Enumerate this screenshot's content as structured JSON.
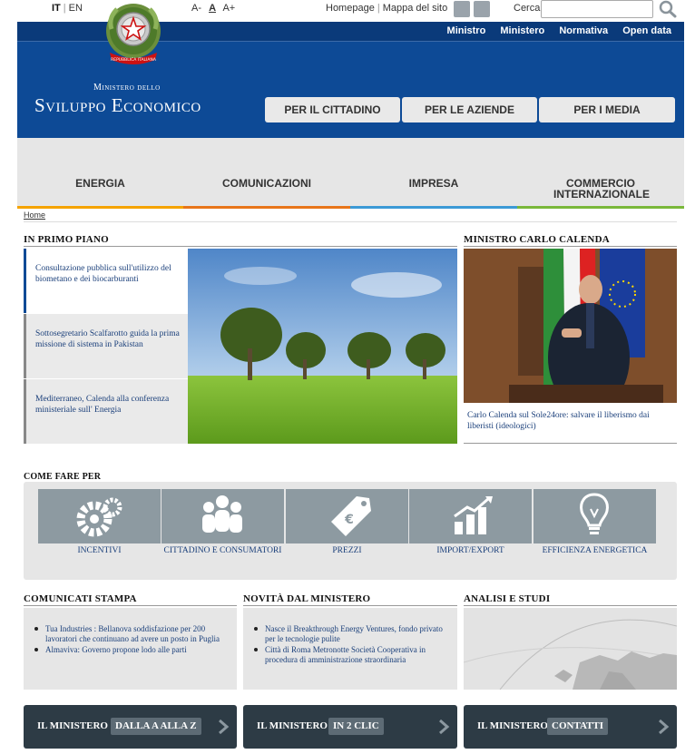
{
  "topbar": {
    "lang_it": "IT",
    "lang_en": "EN",
    "font_small": "A-",
    "font_normal": "A",
    "font_large": "A+",
    "homepage": "Homepage",
    "site_map": "Mappa del sito",
    "search_label": "Cerca",
    "search_placeholder": ""
  },
  "navbar": {
    "links": [
      "Ministro",
      "Ministero",
      "Normativa",
      "Open data"
    ]
  },
  "header": {
    "emblem_text": "REPUBBLICA ITALIANA",
    "logo_small": "Ministero dello",
    "logo_big": "Sviluppo Economico",
    "buttons": [
      "PER IL CITTADINO",
      "PER LE AZIENDE",
      "PER I MEDIA"
    ]
  },
  "sections": {
    "items": [
      "ENERGIA",
      "COMUNICAZIONI",
      "IMPRESA",
      "COMMERCIO INTERNAZIONALE"
    ],
    "colors": [
      "#f5a300",
      "#e8751a",
      "#3c9ad6",
      "#7ab83a"
    ]
  },
  "breadcrumb": "Home",
  "primo_piano": {
    "title": "IN PRIMO PIANO",
    "items": [
      "Consultazione pubblica sull'utilizzo del biometano e dei biocarburanti",
      "Sottosegretario Scalfarotto guida la prima missione di sistema in Pakistan",
      "Mediterraneo, Calenda alla conferenza ministeriale sull' Energia"
    ]
  },
  "ministro": {
    "title": "MINISTRO CARLO CALENDA",
    "caption": "Carlo Calenda sul Sole24ore: salvare il liberismo dai liberisti (ideologici)"
  },
  "come_fare": {
    "title": "COME FARE PER",
    "items": [
      {
        "label": "INCENTIVI",
        "icon": "gears-icon"
      },
      {
        "label": "CITTADINO E CONSUMATORI",
        "icon": "people-icon"
      },
      {
        "label": "PREZZI",
        "icon": "price-tag-icon"
      },
      {
        "label": "IMPORT/EXPORT",
        "icon": "bar-chart-icon"
      },
      {
        "label": "EFFICIENZA ENERGETICA",
        "icon": "lightbulb-icon"
      }
    ]
  },
  "comunicati": {
    "title": "COMUNICATI STAMPA",
    "items": [
      "Tua Industries : Bellanova soddisfazione per 200 lavoratori che continuano ad avere un posto in Puglia",
      "Almaviva: Governo propone lodo alle parti"
    ]
  },
  "novita": {
    "title": "NOVITÀ DAL MINISTERO",
    "items": [
      "Nasce il Breakthrough Energy Ventures, fondo privato per le tecnologie pulite",
      "Città di Roma Metronotte Società Cooperativa in procedura di amministrazione straordinaria"
    ]
  },
  "analisi": {
    "title": "ANALISI E STUDI"
  },
  "bottom_buttons": [
    {
      "prefix": "IL MINISTERO",
      "highlight": "DALLA A ALLA Z"
    },
    {
      "prefix": "IL MINISTERO",
      "highlight": "IN 2 CLIC"
    },
    {
      "prefix": "IL MINISTERO",
      "highlight": "CONTATTI"
    }
  ]
}
